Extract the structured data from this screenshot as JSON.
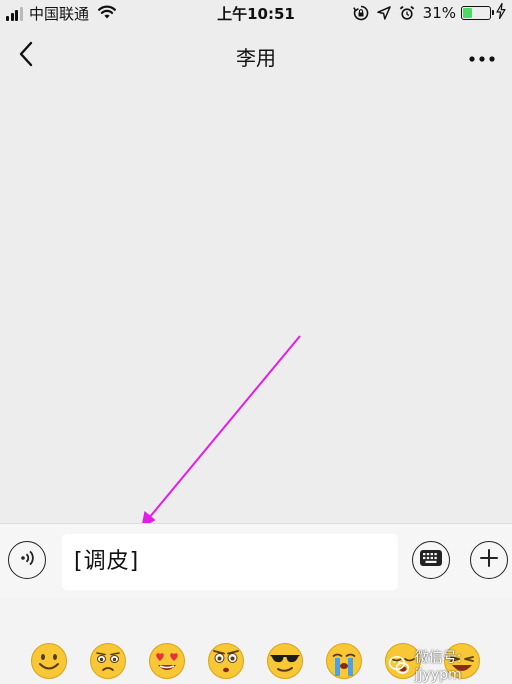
{
  "status_bar": {
    "carrier": "中国联通",
    "time": "上午10:51",
    "battery_pct": "31%",
    "battery_level": 0.31,
    "signal_bars": 4,
    "signal_active": 3,
    "icons": [
      "signal-icon",
      "wifi-icon",
      "rotation-lock-icon",
      "location-icon",
      "alarm-icon",
      "battery-icon",
      "charging-icon"
    ]
  },
  "nav": {
    "title": "李用",
    "back_icon": "chevron-left-icon",
    "more_icon": "more-dots-icon"
  },
  "input_bar": {
    "input_value": "[调皮]",
    "voice_icon": "voice-icon",
    "keyboard_icon": "keyboard-icon",
    "plus_icon": "plus-icon"
  },
  "emoji_panel": {
    "items": [
      "smile",
      "pout",
      "heart-eyes",
      "stare",
      "cool",
      "crying",
      "sleepy",
      "laughing"
    ]
  },
  "annotation": {
    "type": "arrow",
    "color": "#e21de6"
  },
  "watermark": {
    "text": "微信号: jjyypm"
  },
  "colors": {
    "background": "#ededed",
    "input_bar": "#f6f6f6",
    "battery_fill": "#4cd964",
    "emoji_yellow": "#f7c736"
  }
}
